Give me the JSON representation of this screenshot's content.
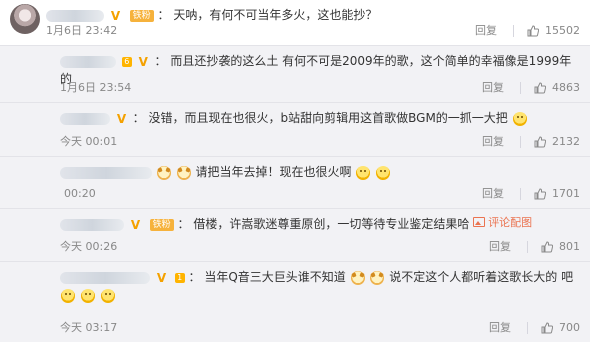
{
  "comments": [
    {
      "kind": "top",
      "fan_badge": "铁粉",
      "text": "天呐，有何不可当年多火，这也能抄？",
      "time": "1月6日 23:42",
      "reply_label": "回复",
      "likes": "15502"
    },
    {
      "kind": "reply",
      "level_badge": "6",
      "text": "而且还抄袭的这么土 有何不可是2009年的歌，这个简单的幸福像是1999年的",
      "time": "1月6日 23:54",
      "reply_label": "回复",
      "likes": "4863"
    },
    {
      "kind": "reply",
      "text": "没错，而且现在也很火，b站甜向剪辑用这首歌做BGM的一抓一大把",
      "time": "今天 00:01",
      "reply_label": "回复",
      "likes": "2132"
    },
    {
      "kind": "reply",
      "text": "请把当年去掉！现在也很火啊",
      "time": "00:20",
      "reply_label": "回复",
      "likes": "1701"
    },
    {
      "kind": "reply",
      "fan_badge": "铁粉",
      "text": "借楼，许嵩歌迷尊重原创，一切等待专业鉴定结果哈",
      "see_pic_label": "评论配图",
      "time": "今天 00:26",
      "reply_label": "回复",
      "likes": "801"
    },
    {
      "kind": "reply",
      "level_badge": "1",
      "text_a": "当年Q音三大巨头谁不知道",
      "text_b": "说不定这个人都听着这歌长大的",
      "text_c": "吧",
      "time": "今天 03:17",
      "reply_label": "回复",
      "likes": "700"
    }
  ],
  "icons": {
    "verified": "v-badge-icon",
    "thumbs_up": "thumbs-up-icon"
  },
  "colors": {
    "top_bg": "#ffffff",
    "reply_bg": "#f2f2f5",
    "link_accent": "#eb7350",
    "badge_orange": "#f4a100"
  }
}
